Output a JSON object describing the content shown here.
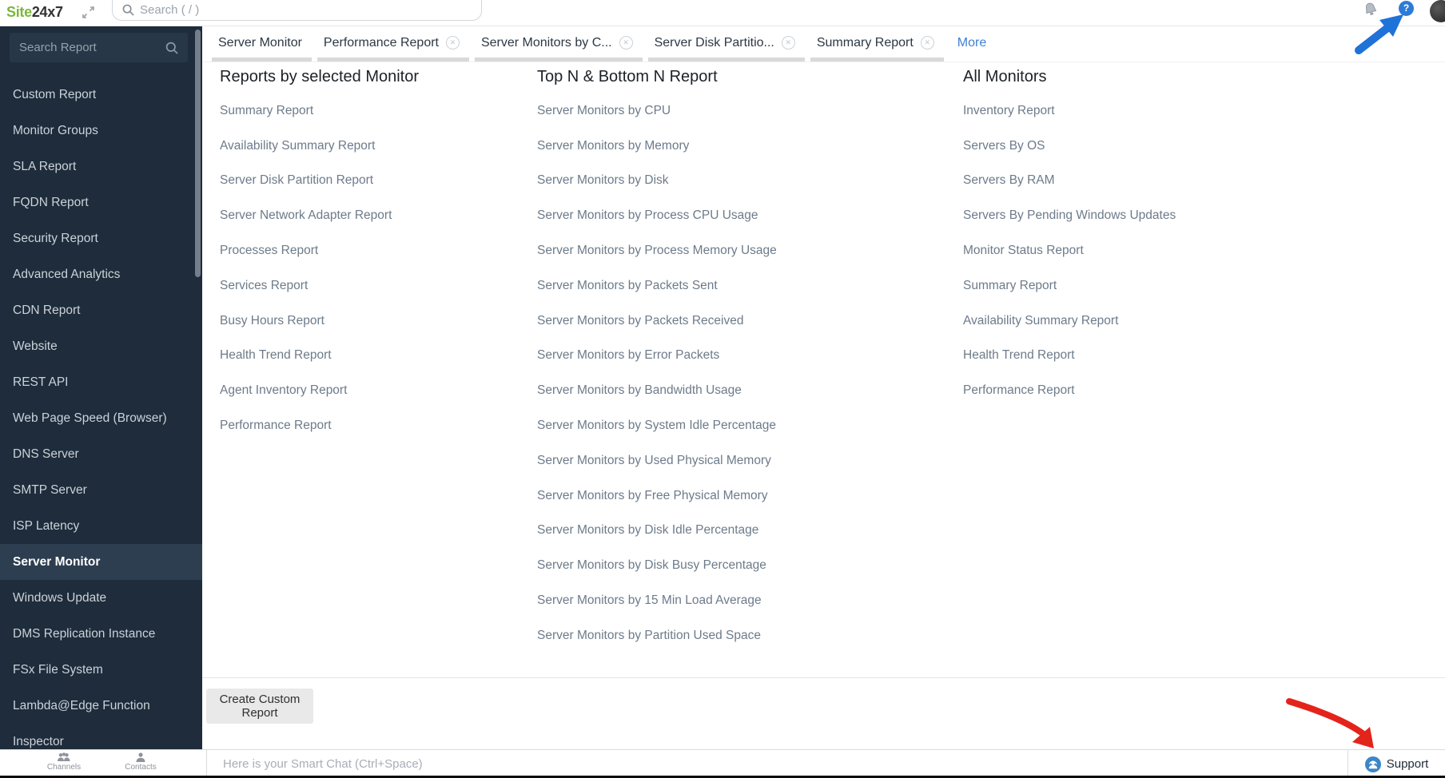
{
  "brand": {
    "logo_green": "Site",
    "logo_dark": "24x7",
    "green_color": "#7cb73d"
  },
  "topbar": {
    "search_placeholder": "Search ( / )",
    "help_glyph": "?",
    "help_color": "#2e7bd6"
  },
  "sidebar": {
    "search_placeholder": "Search Report",
    "items": [
      {
        "label": "Custom Report"
      },
      {
        "label": "Monitor Groups"
      },
      {
        "label": "SLA Report"
      },
      {
        "label": "FQDN Report"
      },
      {
        "label": "Security Report"
      },
      {
        "label": "Advanced Analytics"
      },
      {
        "label": "CDN Report"
      },
      {
        "label": "Website"
      },
      {
        "label": "REST API"
      },
      {
        "label": "Web Page Speed (Browser)"
      },
      {
        "label": "DNS Server"
      },
      {
        "label": "SMTP Server"
      },
      {
        "label": "ISP Latency"
      },
      {
        "label": "Server Monitor",
        "selected": true
      },
      {
        "label": "Windows Update"
      },
      {
        "label": "DMS Replication Instance"
      },
      {
        "label": "FSx File System"
      },
      {
        "label": "Lambda@Edge Function"
      },
      {
        "label": "Inspector"
      }
    ],
    "footer_shortcuts": [
      {
        "label": "Channels"
      },
      {
        "label": "Contacts"
      }
    ]
  },
  "tabs": {
    "close_glyph": "✕",
    "items": [
      {
        "label": "Server Monitor",
        "active": true
      },
      {
        "label": "Performance Report",
        "closable": true
      },
      {
        "label": "Server Monitors by C...",
        "closable": true
      },
      {
        "label": "Server Disk Partitio...",
        "closable": true
      },
      {
        "label": "Summary Report",
        "closable": true
      }
    ],
    "more_label": "More",
    "more_color": "#3f80d6"
  },
  "columns": [
    {
      "title": "Reports by selected Monitor",
      "items": [
        "Summary Report",
        "Availability Summary Report",
        "Server Disk Partition Report",
        "Server Network Adapter Report",
        "Processes Report",
        "Services Report",
        "Busy Hours Report",
        "Health Trend Report",
        "Agent Inventory Report",
        "Performance Report"
      ]
    },
    {
      "title": "Top N & Bottom N Report",
      "items": [
        "Server Monitors by CPU",
        "Server Monitors by Memory",
        "Server Monitors by Disk",
        "Server Monitors by Process CPU Usage",
        "Server Monitors by Process Memory Usage",
        "Server Monitors by Packets Sent",
        "Server Monitors by Packets Received",
        "Server Monitors by Error Packets",
        "Server Monitors by Bandwidth Usage",
        "Server Monitors by System Idle Percentage",
        "Server Monitors by Used Physical Memory",
        "Server Monitors by Free Physical Memory",
        "Server Monitors by Disk Idle Percentage",
        "Server Monitors by Disk Busy Percentage",
        "Server Monitors by 15 Min Load Average",
        "Server Monitors by Partition Used Space"
      ]
    },
    {
      "title": "All Monitors",
      "items": [
        "Inventory Report",
        "Servers By OS",
        "Servers By RAM",
        "Servers By Pending Windows Updates",
        "Monitor Status Report",
        "Summary Report",
        "Availability Summary Report",
        "Health Trend Report",
        "Performance Report"
      ]
    }
  ],
  "footer": {
    "create_button_label": "Create Custom Report",
    "chat_placeholder": "Here is your Smart Chat (Ctrl+Space)",
    "support_label": "Support",
    "support_color": "#3c86c8"
  },
  "annotations": {
    "blue_arrow_color": "#1f72d8",
    "red_arrow_color": "#e3241b"
  }
}
